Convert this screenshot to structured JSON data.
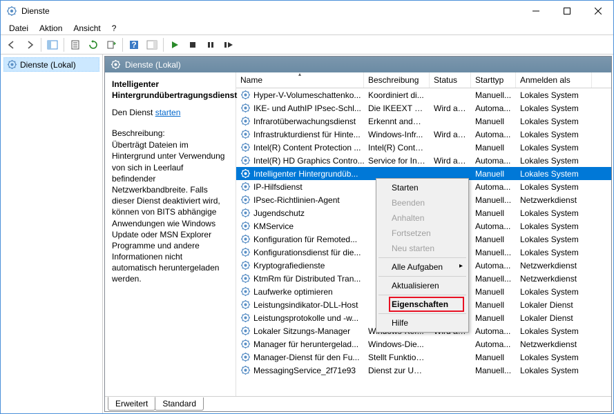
{
  "window": {
    "title": "Dienste"
  },
  "menu": {
    "file": "Datei",
    "action": "Aktion",
    "view": "Ansicht",
    "help": "?"
  },
  "tree": {
    "root": "Dienste (Lokal)"
  },
  "content": {
    "header": "Dienste (Lokal)"
  },
  "desc": {
    "title": "Intelligenter Hintergrundübertragungsdienst",
    "action_prefix": "Den Dienst ",
    "action_link": "starten",
    "label": "Beschreibung:",
    "text": "Überträgt Dateien im Hintergrund unter Verwendung von sich in Leerlauf befindender Netzwerkbandbreite. Falls dieser Dienst deaktiviert wird, können von BITS abhängige Anwendungen wie Windows Update oder MSN Explorer Programme und andere Informationen nicht automatisch heruntergeladen werden."
  },
  "columns": {
    "name": "Name",
    "desc": "Beschreibung",
    "status": "Status",
    "start": "Starttyp",
    "logon": "Anmelden als"
  },
  "rows": [
    {
      "name": "Hyper-V-Volumeschattenko...",
      "desc": "Koordiniert di...",
      "status": "",
      "start": "Manuell...",
      "logon": "Lokales System"
    },
    {
      "name": "IKE- und AuthIP IPsec-Schl...",
      "desc": "Die IKEEXT di...",
      "status": "Wird au...",
      "start": "Automa...",
      "logon": "Lokales System"
    },
    {
      "name": "Infrarotüberwachungsdienst",
      "desc": "Erkennt ander...",
      "status": "",
      "start": "Manuell",
      "logon": "Lokales System"
    },
    {
      "name": "Infrastrukturdienst für Hinte...",
      "desc": "Windows-Infr...",
      "status": "Wird au...",
      "start": "Automa...",
      "logon": "Lokales System"
    },
    {
      "name": "Intel(R) Content Protection ...",
      "desc": "Intel(R) Conte...",
      "status": "",
      "start": "Manuell",
      "logon": "Lokales System"
    },
    {
      "name": "Intel(R) HD Graphics Contro...",
      "desc": "Service for Int...",
      "status": "Wird au...",
      "start": "Automa...",
      "logon": "Lokales System"
    },
    {
      "name": "Intelligenter Hintergrundüb...",
      "desc": "",
      "status": "",
      "start": "Manuell",
      "logon": "Lokales System",
      "selected": true
    },
    {
      "name": "IP-Hilfsdienst",
      "desc": "",
      "status": "",
      "start": "Automa...",
      "logon": "Lokales System"
    },
    {
      "name": "IPsec-Richtlinien-Agent",
      "desc": "",
      "status": "",
      "start": "Manuell...",
      "logon": "Netzwerkdienst"
    },
    {
      "name": "Jugendschutz",
      "desc": "",
      "status": "",
      "start": "Manuell",
      "logon": "Lokales System"
    },
    {
      "name": "KMService",
      "desc": "",
      "status": "",
      "start": "Automa...",
      "logon": "Lokales System"
    },
    {
      "name": "Konfiguration für Remoted...",
      "desc": "",
      "status": "",
      "start": "Manuell",
      "logon": "Lokales System"
    },
    {
      "name": "Konfigurationsdienst für die...",
      "desc": "",
      "status": "",
      "start": "Manuell...",
      "logon": "Lokales System"
    },
    {
      "name": "Kryptografiedienste",
      "desc": "",
      "status": "",
      "start": "Automa...",
      "logon": "Netzwerkdienst"
    },
    {
      "name": "KtmRm für Distributed Tran...",
      "desc": "",
      "status": "",
      "start": "Manuell...",
      "logon": "Netzwerkdienst"
    },
    {
      "name": "Laufwerke optimieren",
      "desc": "",
      "status": "",
      "start": "Manuell",
      "logon": "Lokales System"
    },
    {
      "name": "Leistungsindikator-DLL-Host",
      "desc": "",
      "status": "",
      "start": "Manuell",
      "logon": "Lokaler Dienst"
    },
    {
      "name": "Leistungsprotokolle und -w...",
      "desc": "",
      "status": "",
      "start": "Manuell",
      "logon": "Lokaler Dienst"
    },
    {
      "name": "Lokaler Sitzungs-Manager",
      "desc": "Windows-Ker...",
      "status": "Wird au...",
      "start": "Automa...",
      "logon": "Lokales System"
    },
    {
      "name": "Manager für heruntergelad...",
      "desc": "Windows-Die...",
      "status": "",
      "start": "Automa...",
      "logon": "Netzwerkdienst"
    },
    {
      "name": "Manager-Dienst für den Fu...",
      "desc": "Stellt Funktion...",
      "status": "",
      "start": "Manuell",
      "logon": "Lokales System"
    },
    {
      "name": "MessagingService_2f71e93",
      "desc": "Dienst zur Unt...",
      "status": "",
      "start": "Manuell...",
      "logon": "Lokales System"
    }
  ],
  "tabs": {
    "extended": "Erweitert",
    "standard": "Standard"
  },
  "context": {
    "start": "Starten",
    "stop": "Beenden",
    "pause": "Anhalten",
    "resume": "Fortsetzen",
    "restart": "Neu starten",
    "alltasks": "Alle Aufgaben",
    "refresh": "Aktualisieren",
    "properties": "Eigenschaften",
    "help": "Hilfe"
  }
}
